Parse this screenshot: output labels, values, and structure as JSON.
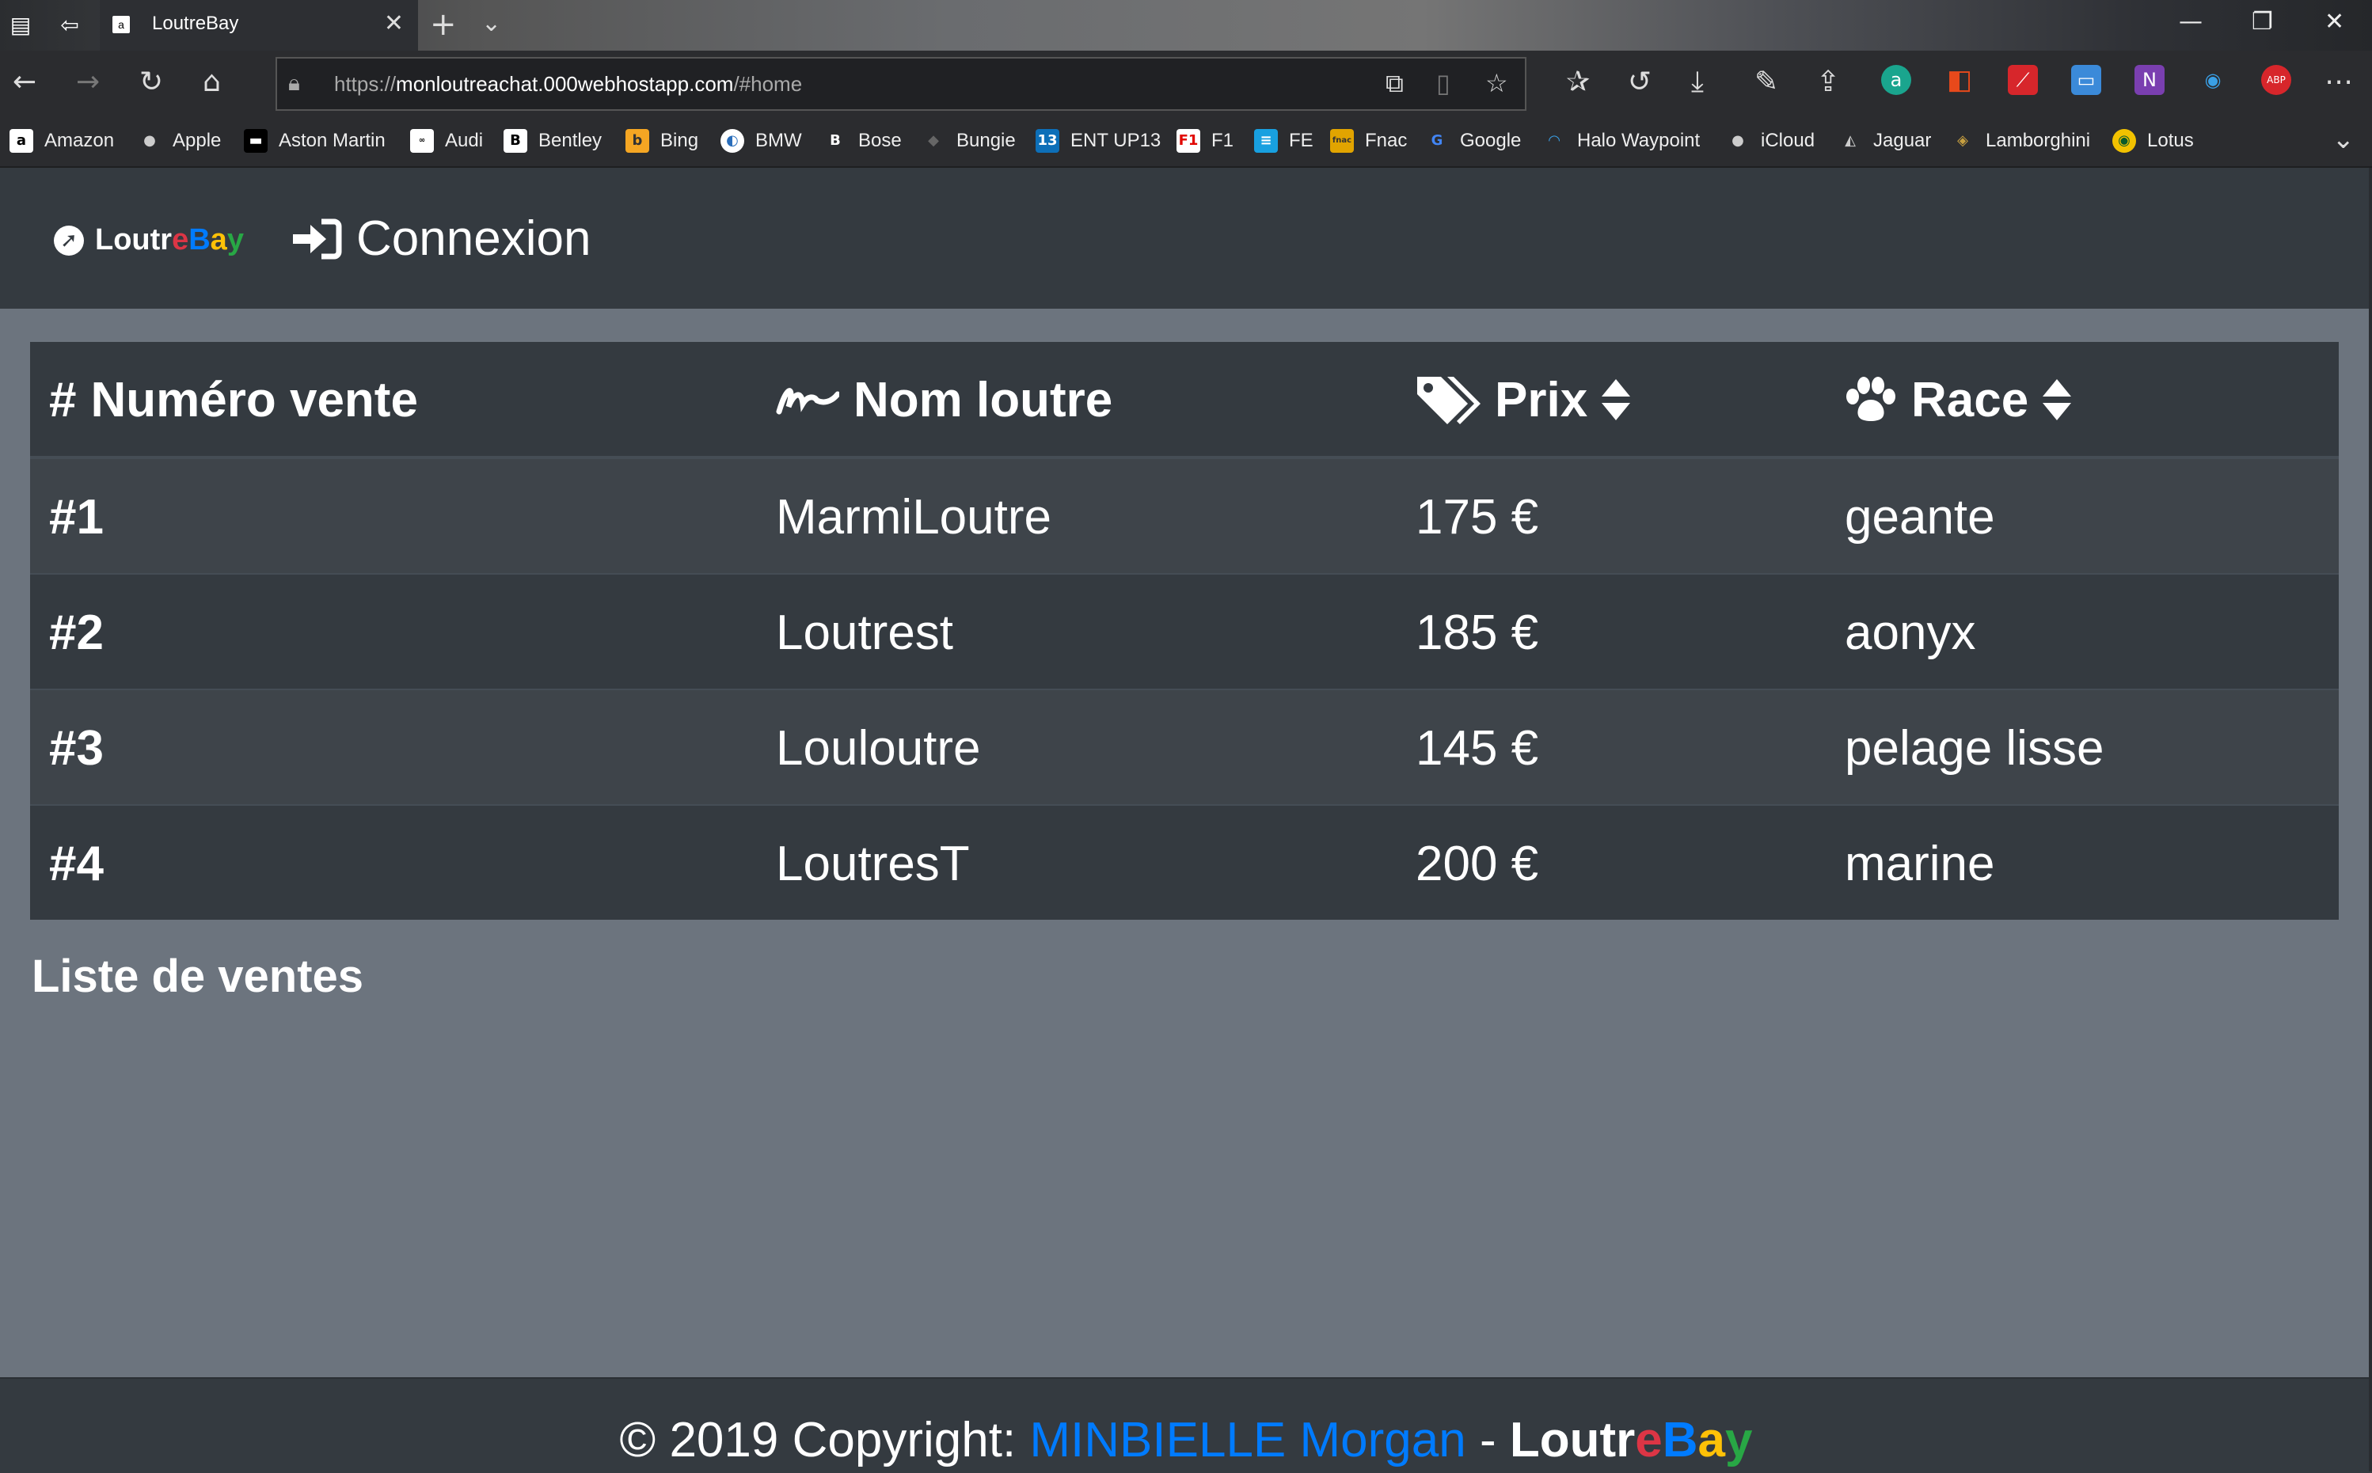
{
  "browser": {
    "tab_title": "LoutreBay",
    "url_scheme": "https://",
    "url_host": "monloutreachat.000webhostapp.com",
    "url_path": "/#home",
    "bookmarks": [
      "Amazon",
      "Apple",
      "Aston Martin",
      "Audi",
      "Bentley",
      "Bing",
      "BMW",
      "Bose",
      "Bungie",
      "ENT UP13",
      "F1",
      "FE",
      "Fnac",
      "Google",
      "Halo Waypoint",
      "iCloud",
      "Jaguar",
      "Lamborghini",
      "Lotus"
    ]
  },
  "site": {
    "brand_parts": [
      "Loutr",
      "e",
      "B",
      "a",
      "y"
    ],
    "brand_colors": [
      "#ffffff",
      "#dc3545",
      "#007bff",
      "#ffc107",
      "#28a745"
    ],
    "login_label": "Connexion"
  },
  "table": {
    "headers": {
      "sale_number": "Numéro vente",
      "otter_name": "Nom loutre",
      "price": "Prix",
      "breed": "Race"
    },
    "rows": [
      {
        "num": "#1",
        "name": "MarmiLoutre",
        "price": "175 €",
        "breed": "geante"
      },
      {
        "num": "#2",
        "name": "Loutrest",
        "price": "185 €",
        "breed": "aonyx"
      },
      {
        "num": "#3",
        "name": "Louloutre",
        "price": "145 €",
        "breed": "pelage lisse"
      },
      {
        "num": "#4",
        "name": "LoutresT",
        "price": "200 €",
        "breed": "marine"
      }
    ],
    "caption": "Liste de ventes"
  },
  "footer": {
    "prefix": "© 2019 Copyright: ",
    "author": "MINBIELLE Morgan",
    "separator": " - "
  }
}
